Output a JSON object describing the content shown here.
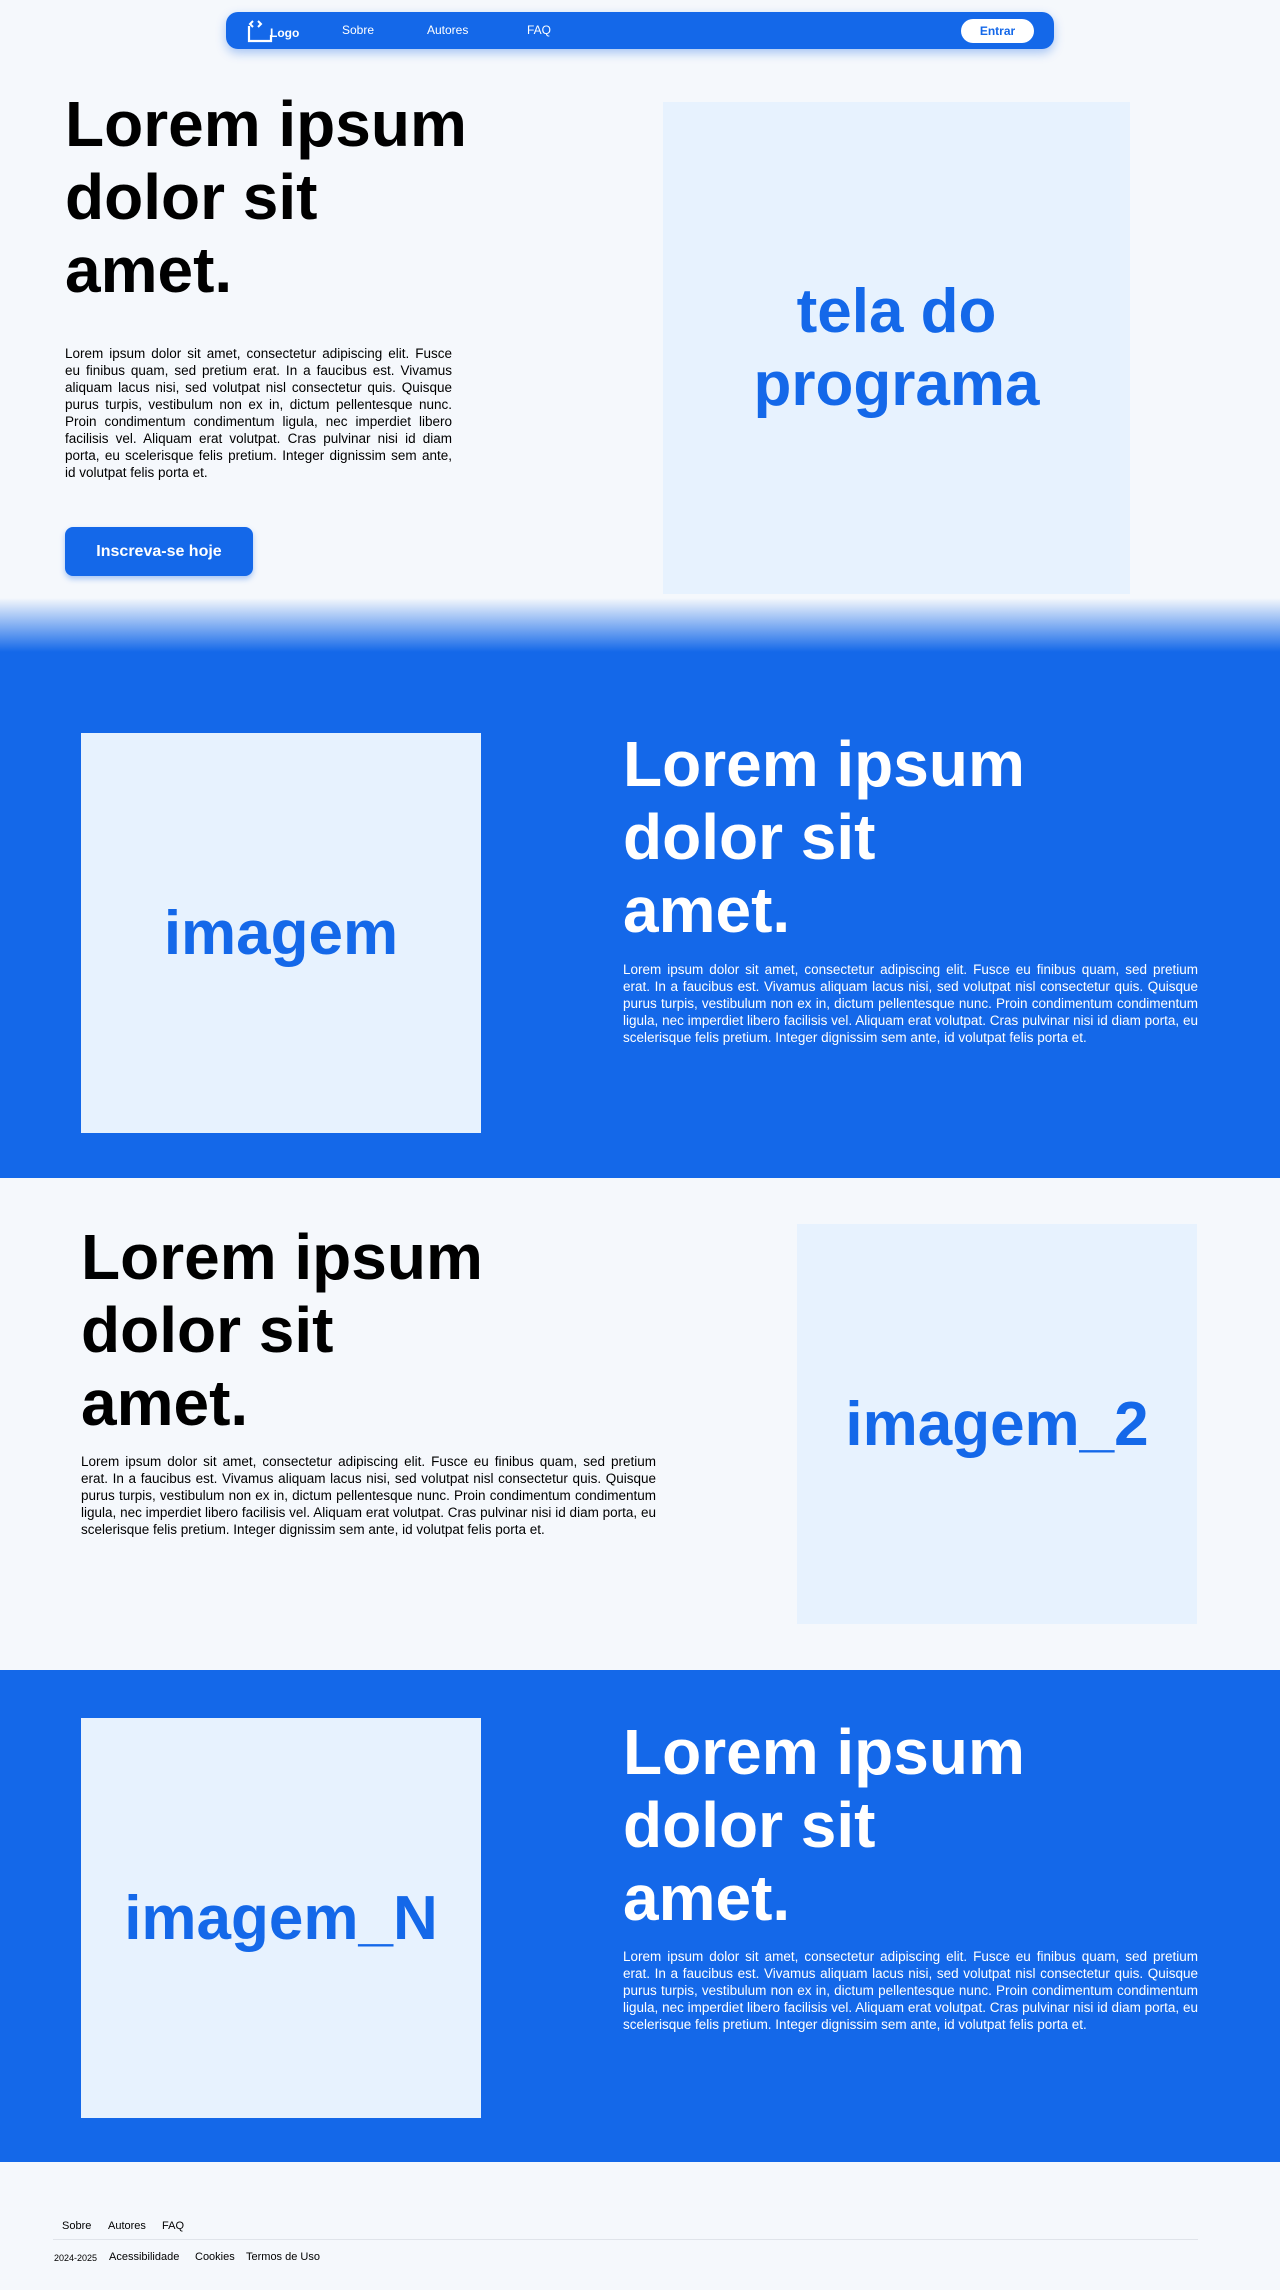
{
  "nav": {
    "logo_text": "Logo",
    "links": [
      "Sobre",
      "Autores",
      "FAQ"
    ],
    "login_label": "Entrar"
  },
  "hero": {
    "title": "Lorem ipsum dolor sit amet.",
    "text": "Lorem ipsum dolor sit amet, consectetur adipiscing elit. Fusce eu finibus quam, sed pretium erat. In a faucibus est. Vivamus aliquam lacus nisi, sed volutpat nisl consectetur quis. Quisque purus turpis, vestibulum non ex in, dictum pellentesque nunc. Proin condimentum condimentum ligula, nec imperdiet libero facilisis vel. Aliquam erat volutpat. Cras pulvinar nisi id diam porta, eu scelerisque felis pretium. Integer dignissim sem ante, id volutpat felis porta et.",
    "cta_label": "Inscreva-se hoje",
    "image_label": "tela do programa"
  },
  "sections": [
    {
      "image_label": "imagem",
      "title": "Lorem ipsum dolor sit amet.",
      "text": "Lorem ipsum dolor sit amet, consectetur adipiscing elit. Fusce eu finibus quam, sed pretium erat. In a faucibus est. Vivamus aliquam lacus nisi, sed volutpat nisl consectetur quis. Quisque purus turpis, vestibulum non ex in, dictum pellentesque nunc. Proin condimentum condimentum ligula, nec imperdiet libero facilisis vel. Aliquam erat volutpat. Cras pulvinar nisi id diam porta, eu scelerisque felis pretium. Integer dignissim sem ante, id volutpat felis porta et."
    },
    {
      "image_label": "imagem_2",
      "title": "Lorem ipsum dolor sit amet.",
      "text": "Lorem ipsum dolor sit amet, consectetur adipiscing elit. Fusce eu finibus quam, sed pretium erat. In a faucibus est. Vivamus aliquam lacus nisi, sed volutpat nisl consectetur quis. Quisque purus turpis, vestibulum non ex in, dictum pellentesque nunc. Proin condimentum condimentum ligula, nec imperdiet libero facilisis vel. Aliquam erat volutpat. Cras pulvinar nisi id diam porta, eu scelerisque felis pretium. Integer dignissim sem ante, id volutpat felis porta et."
    },
    {
      "image_label": "imagem_N",
      "title": "Lorem ipsum dolor sit amet.",
      "text": "Lorem ipsum dolor sit amet, consectetur adipiscing elit. Fusce eu finibus quam, sed pretium erat. In a faucibus est. Vivamus aliquam lacus nisi, sed volutpat nisl consectetur quis. Quisque purus turpis, vestibulum non ex in, dictum pellentesque nunc. Proin condimentum condimentum ligula, nec imperdiet libero facilisis vel. Aliquam erat volutpat. Cras pulvinar nisi id diam porta, eu scelerisque felis pretium. Integer dignissim sem ante, id volutpat felis porta et."
    }
  ],
  "footer": {
    "links": [
      "Sobre",
      "Autores",
      "FAQ"
    ],
    "year": "2024-2025",
    "legal_links": [
      "Acessibilidade",
      "Cookies",
      "Termos de Uso"
    ]
  },
  "colors": {
    "primary": "#1468e9",
    "background": "#f5f8fc",
    "placeholder": "#e7f2fe"
  }
}
